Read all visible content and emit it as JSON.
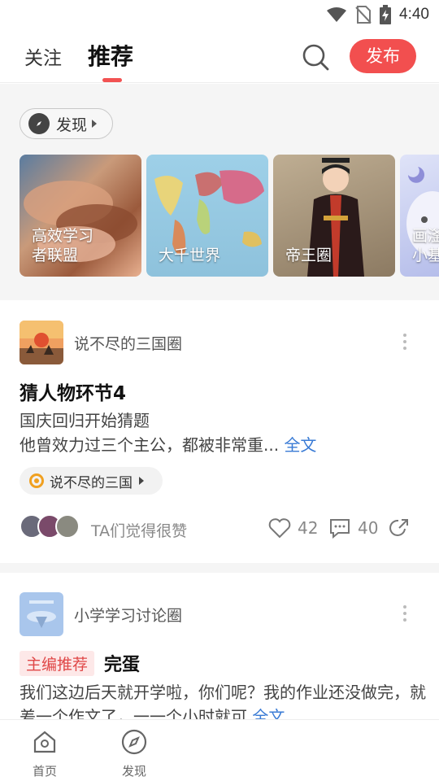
{
  "status_bar": {
    "time": "4:40"
  },
  "top_nav": {
    "tab_follow": "关注",
    "tab_recommend": "推荐",
    "publish_label": "发布"
  },
  "discover": {
    "label": "发现",
    "cards": [
      {
        "label": "高效学习\n者联盟"
      },
      {
        "label": "大千世界"
      },
      {
        "label": "帝王圈"
      },
      {
        "label": "画滏\n小基"
      }
    ]
  },
  "posts": [
    {
      "circle_name": "说不尽的三国圈",
      "title": "猜人物环节4",
      "body_line1": "国庆回归开始猜题",
      "body_line2": "他曾效力过三个主公，都被非常重...",
      "full_text_label": "全文",
      "topic": "说不尽的三国",
      "likers_text": "TA们觉得很赞",
      "like_count": "42",
      "comment_count": "40"
    },
    {
      "circle_name": "小学学习讨论圈",
      "badge": "主编推荐",
      "title": "完蛋",
      "body": "我们这边后天就开学啦，你们呢？我的作业还没做完，就差一个作文了，一一个小时就可",
      "full_text_label": "全文"
    }
  ],
  "bottom_nav": {
    "home_label": "首页",
    "discover_label": "发现"
  },
  "colors": {
    "accent": "#f24f4f",
    "link": "#3a7bd5",
    "topic": "#f0a020"
  }
}
